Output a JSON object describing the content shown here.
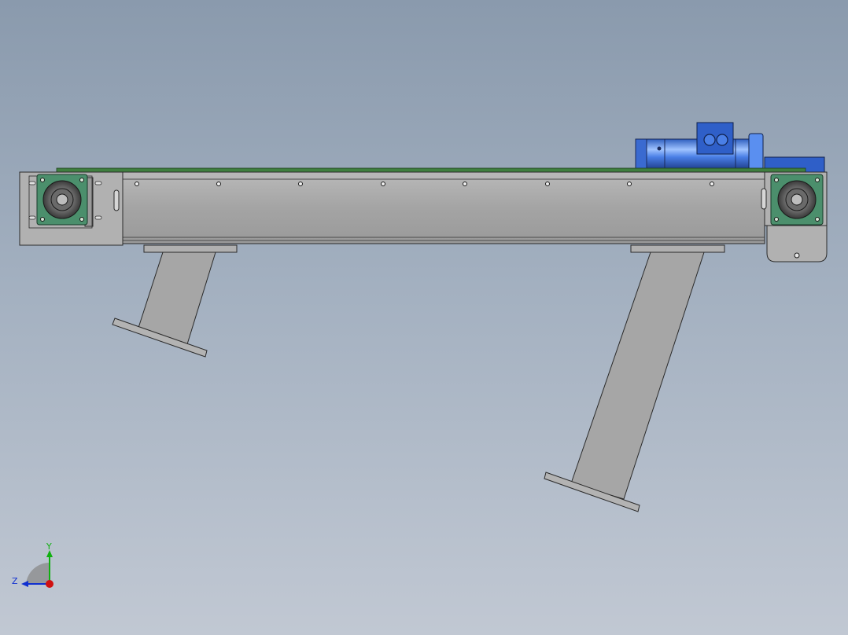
{
  "viewport": {
    "background_top": "#8a9aad",
    "background_bottom": "#c1c8d3"
  },
  "model": {
    "frame_color": "#a9a9a9",
    "belt_color": "#3f7f3f",
    "bearing_color": "#4b8f6c",
    "motor_color": "#3b6fd6",
    "leg_color": "#a6a6a6",
    "outline_color": "#2a2a2a"
  },
  "triad": {
    "x_color": "#d01010",
    "y_color": "#10b010",
    "z_color": "#1030d0",
    "y_label": "Y",
    "z_label": "Z"
  }
}
